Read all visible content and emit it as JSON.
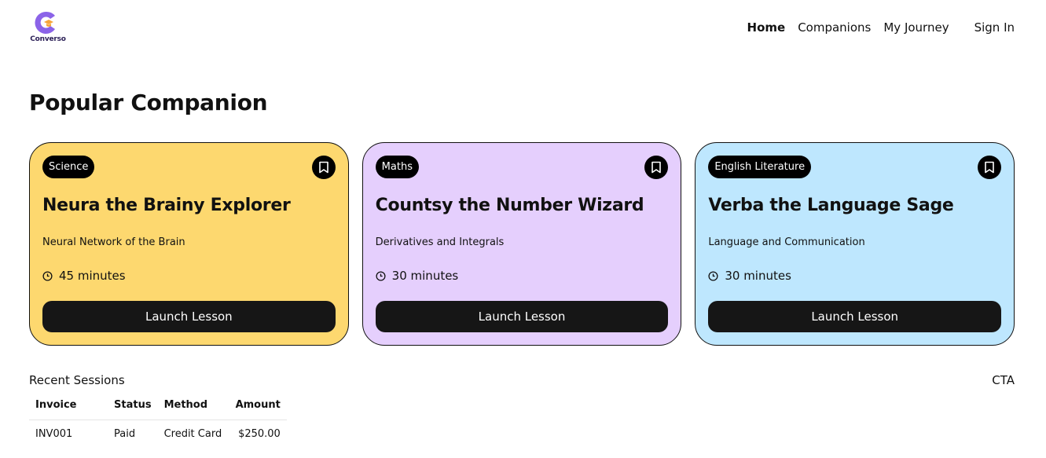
{
  "brand": {
    "name": "Converso",
    "colors": {
      "logo_purple": "#8b63e8",
      "logo_orange": "#f7a53a"
    }
  },
  "nav": {
    "home": "Home",
    "companions": "Companions",
    "journey": "My Journey",
    "sign_in": "Sign In"
  },
  "page": {
    "title": "Popular Companion"
  },
  "cards": [
    {
      "subject": "Science",
      "name": "Neura the Brainy Explorer",
      "topic": "Neural Network of the Brain",
      "duration": "45 minutes",
      "button": "Launch Lesson",
      "color": "#fdd86f"
    },
    {
      "subject": "Maths",
      "name": "Countsy the Number Wizard",
      "topic": "Derivatives and Integrals",
      "duration": "30 minutes",
      "button": "Launch Lesson",
      "color": "#e5cffd"
    },
    {
      "subject": "English Literature",
      "name": "Verba the Language Sage",
      "topic": "Language and Communication",
      "duration": "30 minutes",
      "button": "Launch Lesson",
      "color": "#bee7fe"
    }
  ],
  "recent": {
    "title": "Recent Sessions",
    "cta": "CTA",
    "columns": [
      "Invoice",
      "Status",
      "Method",
      "Amount"
    ],
    "rows": [
      [
        "INV001",
        "Paid",
        "Credit Card",
        "$250.00"
      ]
    ]
  }
}
